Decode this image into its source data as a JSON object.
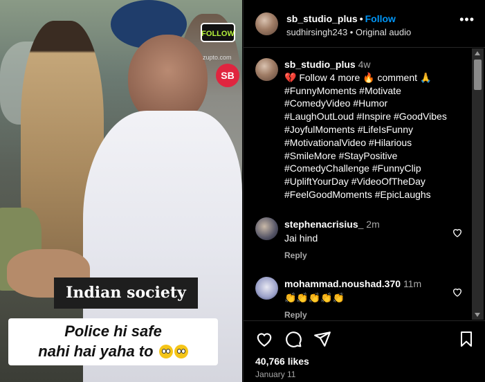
{
  "video": {
    "overlay_tag": "Indian society",
    "subtitle_line1": "Police hi safe",
    "subtitle_line2": "nahi hai yaha to",
    "follow_badge": "FOLLOW",
    "watermark": "zupto.com",
    "channel_badge": "SB"
  },
  "post": {
    "username": "sb_studio_plus",
    "follow_label": "Follow",
    "audio_user": "sudhirsingh243",
    "audio_label": "Original audio",
    "more_icon": "ellipsis-icon"
  },
  "caption": {
    "username": "sb_studio_plus",
    "age": "4w",
    "lines": [
      "💔 Follow 4 more 🔥 comment 🙏",
      "#FunnyMoments #Motivate",
      "#ComedyVideo #Humor",
      "#LaughOutLoud #Inspire #GoodVibes",
      "#JoyfulMoments #LifeIsFunny",
      "#MotivationalVideo #Hilarious",
      "#SmileMore #StayPositive",
      "#ComedyChallenge #FunnyClip",
      "#UpliftYourDay #VideoOfTheDay",
      "#FeelGoodMoments #EpicLaughs"
    ]
  },
  "comments": [
    {
      "username": "stephenacrisius_",
      "age": "2m",
      "text": "Jai hind",
      "reply_label": "Reply"
    },
    {
      "username": "mohammad.noushad.370",
      "age": "11m",
      "text": "👏👏👏👏👏",
      "reply_label": "Reply"
    }
  ],
  "footer": {
    "likes": "40,766 likes",
    "date": "January 11"
  },
  "colors": {
    "accent": "#0095f6",
    "background": "#000000",
    "muted": "#a8a8a8"
  }
}
